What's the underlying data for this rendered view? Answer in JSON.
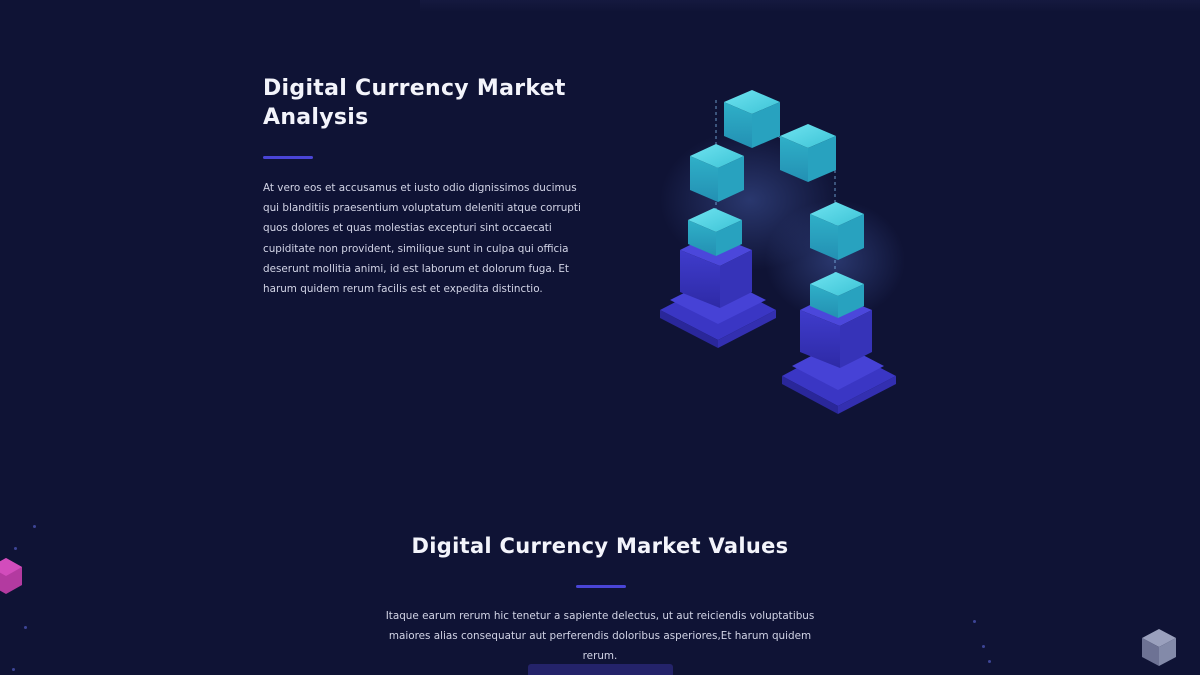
{
  "analysis": {
    "title": "Digital Currency Market Analysis",
    "text": "At vero eos et accusamus et iusto odio dignissimos ducimus qui blanditiis praesentium voluptatum deleniti atque corrupti quos dolores et quas molestias excepturi sint occaecati cupiditate non provident, similique sunt in culpa qui officia deserunt mollitia animi, id est laborum et dolorum fuga. Et harum quidem rerum facilis est et expedita distinctio.",
    "illustration_icon": "blockchain-blocks-illustration"
  },
  "values": {
    "title": "Digital Currency Market Values",
    "text": "Itaque earum rerum hic tenetur a sapiente delectus, ut aut reiciendis voluptatibus maiores alias consequatur aut perferendis doloribus asperiores,Et harum quidem rerum."
  },
  "colors": {
    "background": "#0f1335",
    "accent": "#4a45d6",
    "block_cyan": "#3cc3d6",
    "pedestal_blue": "#3a36c4",
    "button": "#24236a"
  },
  "decorations": {
    "left_icon": "magenta-hexagon-icon",
    "right_icon": "grey-cube-icon"
  }
}
